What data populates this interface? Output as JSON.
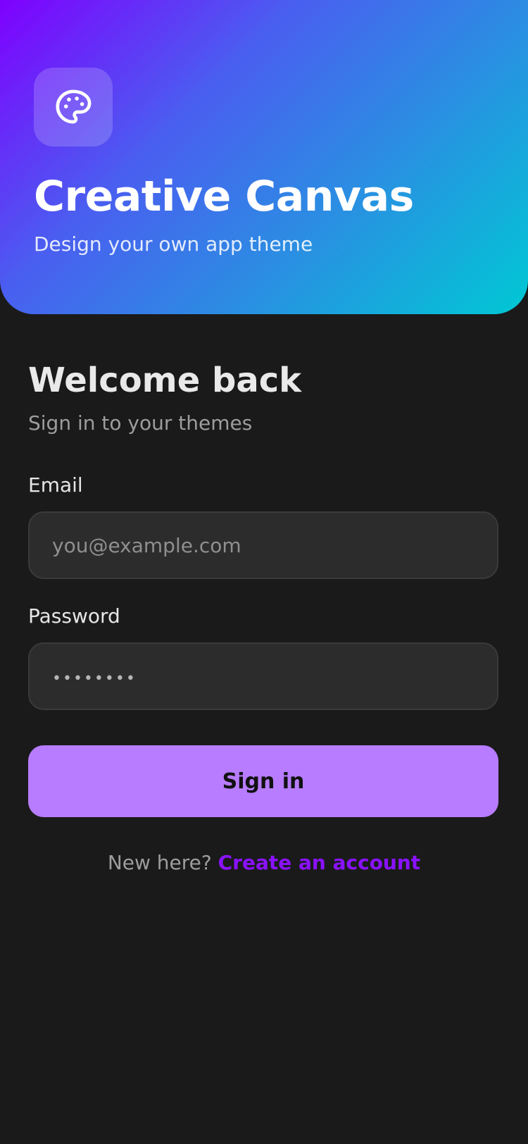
{
  "hero": {
    "icon": "palette-icon",
    "title": "Creative Canvas",
    "subtitle": "Design your own app theme"
  },
  "login": {
    "title": "Welcome back",
    "subtitle": "Sign in to your themes",
    "email": {
      "label": "Email",
      "placeholder": "you@example.com",
      "value": ""
    },
    "password": {
      "label": "Password",
      "placeholder": "••••••••",
      "value": ""
    },
    "submit_label": "Sign in",
    "signup_prompt": "New here?",
    "signup_link": "Create an account"
  },
  "colors": {
    "background": "#1a1a1a",
    "accent": "#b77cff",
    "link": "#8a12ff",
    "gradient_start": "#7f00ff",
    "gradient_end": "#00c8d4"
  }
}
